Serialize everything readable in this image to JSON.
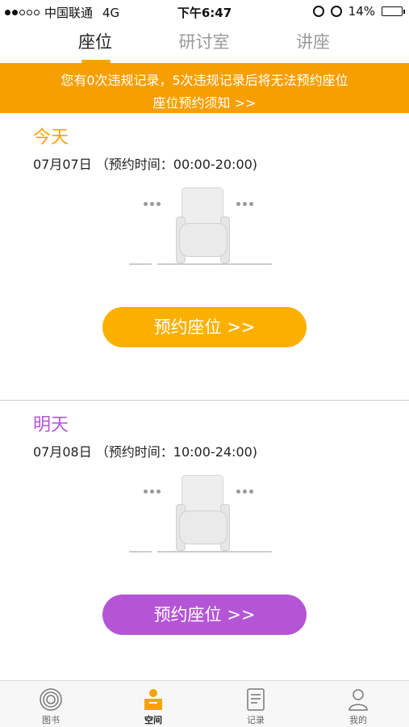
{
  "status_bar": {
    "carrier": "中国联通",
    "network": "4G",
    "time": "下午6:47",
    "battery": "14%",
    "battery_level": 0.14
  },
  "tabs": [
    {
      "label": "座位",
      "active": true
    },
    {
      "label": "研讨室",
      "active": false
    },
    {
      "label": "讲座",
      "active": false
    }
  ],
  "notice": {
    "text": "您有0次违规记录，5次违规记录后将无法预约座位",
    "link": "座位预约须知 >>"
  },
  "days": [
    {
      "title": "今天",
      "date_text": "07月07日 （预约时间：00:00-20:00)",
      "button_label": "预约座位 >>",
      "color": "#f7a400",
      "button_color": "#fbb000"
    },
    {
      "title": "明天",
      "date_text": "07月08日 （预约时间：10:00-24:00)",
      "button_label": "预约座位 >>",
      "color": "#b455d6",
      "button_color": "#b455d6"
    }
  ],
  "tabbar": [
    {
      "label": "图书",
      "icon": "library-icon",
      "active": false
    },
    {
      "label": "空间",
      "icon": "space-icon",
      "active": true
    },
    {
      "label": "记录",
      "icon": "record-icon",
      "active": false
    },
    {
      "label": "我的",
      "icon": "profile-icon",
      "active": false
    }
  ]
}
